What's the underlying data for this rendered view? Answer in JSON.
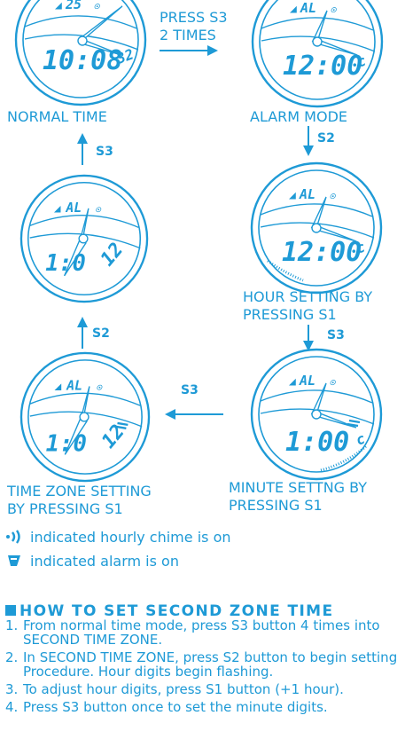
{
  "watches": {
    "normal": {
      "digits_top": "25",
      "time": "10:08",
      "sec": "32",
      "caption": "NORMAL TIME"
    },
    "alarm": {
      "digits_top": "AL",
      "time": "12:00",
      "sec": "c",
      "caption": "ALARM MODE"
    },
    "hour": {
      "digits_top": "AL",
      "time": "12:00",
      "sec": "c",
      "caption_line1": "HOUR SETTING BY",
      "caption_line2": "PRESSING S1"
    },
    "zone": {
      "digits_top": "AL",
      "time": "1:0",
      "sec": "12",
      "caption_line1": "TIME ZONE SETTING",
      "caption_line2": "BY PRESSING S1"
    },
    "settime": {
      "digits_top": "AL",
      "time": "1:0",
      "sec": "12",
      "caption": ""
    },
    "minute": {
      "digits_top": "AL",
      "time": "1:00",
      "sec": "c",
      "caption_line1": "MINUTE SETTNG BY",
      "caption_line2": "PRESSING S1"
    }
  },
  "arrows": {
    "press_s3_line1": "PRESS S3",
    "press_s3_line2": "2 TIMES",
    "s2_a": "S2",
    "s3_b": "S3",
    "s3_c": "S3",
    "s2_d": "S2",
    "s3_e": "S3"
  },
  "legend": {
    "chime": "indicated hourly chime is on",
    "alarm": "indicated alarm is on"
  },
  "section": {
    "title": "HOW TO SET SECOND ZONE TIME",
    "steps": [
      {
        "num": "1.",
        "text": "From normal time mode, press S3 button 4 times into SECOND TIME ZONE."
      },
      {
        "num": "2.",
        "text": "In SECOND TIME ZONE, press S2 button to begin setting Procedure.  Hour digits begin flashing."
      },
      {
        "num": "3.",
        "text": "To adjust hour digits, press S1 button (+1 hour)."
      },
      {
        "num": "4.",
        "text": "Press S3 button once to set the minute digits."
      }
    ]
  },
  "colors": {
    "ink": "#1e9ad6"
  }
}
